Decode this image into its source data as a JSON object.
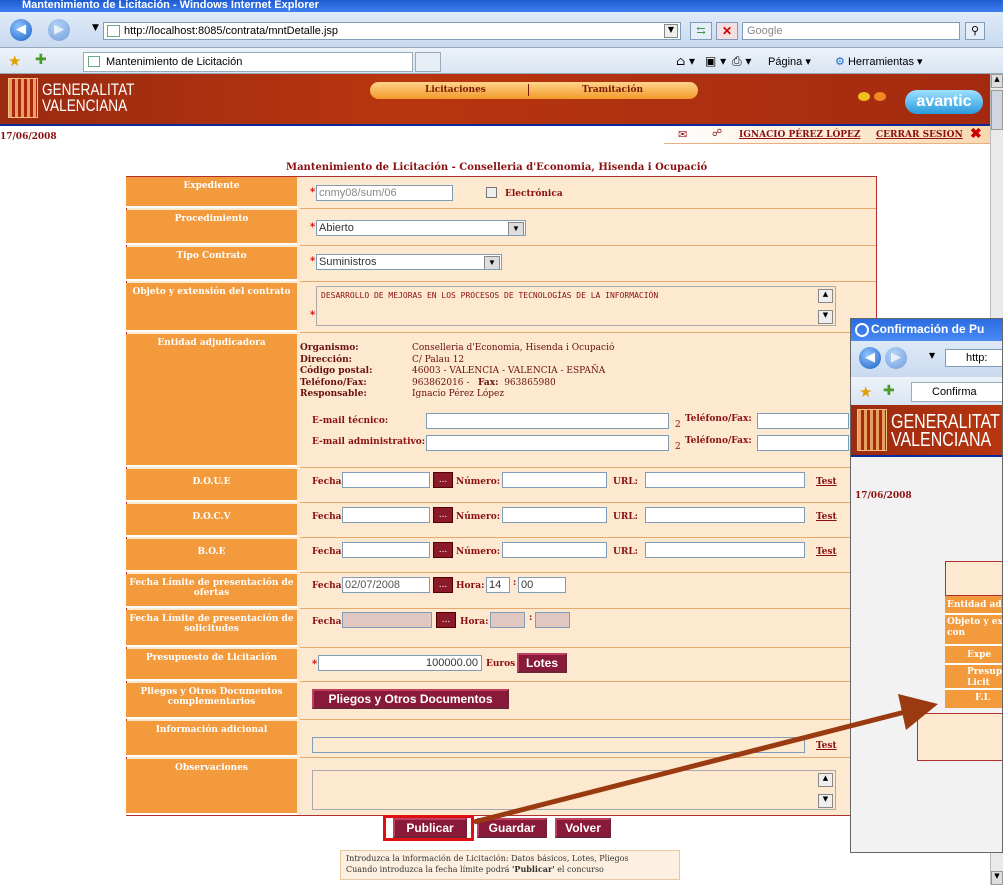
{
  "browser": {
    "window_title": "Mantenimiento de Licitación - Windows Internet Explorer",
    "url": "http://localhost:8085/contrata/mntDetalle.jsp",
    "search_placeholder": "Google",
    "tab_title": "Mantenimiento de Licitación",
    "tools": {
      "page": "Página",
      "tools": "Herramientas"
    }
  },
  "header": {
    "logo_line1": "GENERALITAT",
    "logo_line2": "VALENCIANA",
    "menu": [
      "Licitaciones",
      "Tramitación"
    ],
    "brand": "avantic",
    "date": "17/06/2008",
    "user": "IGNACIO PÉREZ LÓPEZ",
    "logout": "CERRAR SESION"
  },
  "form": {
    "title": "Mantenimiento de Licitación - Conselleria d'Economia, Hisenda i Ocupació",
    "labels": {
      "expediente": "Expediente",
      "procedimiento": "Procedimiento",
      "tipo": "Tipo Contrato",
      "objeto": "Objeto y extensión del contrato",
      "entidad": "Entidad adjudicadora",
      "doue": "D.O.U.E",
      "docv": "D.O.C.V",
      "boe": "B.O.E",
      "limite_ofertas": "Fecha Límite de presentación de ofertas",
      "limite_solicitudes": "Fecha Límite de presentación de solicitudes",
      "presupuesto": "Presupuesto de Licitación",
      "pliegos": "Pliegos y Otros Documentos complementarios",
      "info_adicional": "Información adicional",
      "observaciones": "Observaciones"
    },
    "expediente_value": "cnmy08/sum/06",
    "electronica_label": "Electrónica",
    "procedimiento_value": "Abierto",
    "tipo_value": "Suministros",
    "objeto_value": "DESARROLLO DE MEJORAS EN LOS PROCESOS DE TECNOLOGÍAS DE LA INFORMACIÓN",
    "entidad": {
      "organismo_label": "Organismo:",
      "organismo": "Conselleria d'Economia, Hisenda i Ocupació",
      "direccion_label": "Dirección:",
      "direccion": "C/ Palau 12",
      "cp_label": "Código postal:",
      "cp": "46003 - VALENCIA - VALENCIA - ESPAÑA",
      "tel_label": "Teléfono/Fax:",
      "tel": "963862016 -",
      "fax_label": "Fax:",
      "fax": "963865980",
      "resp_label": "Responsable:",
      "resp": "Ignacio Pérez López",
      "email_tec_label": "E-mail técnico:",
      "email_adm_label": "E-mail administrativo:",
      "telfax_label": "Teléfono/Fax:",
      "sup": "2"
    },
    "fecha_label": "Fecha",
    "numero_label": "Número:",
    "url_label": "URL:",
    "test_label": "Test",
    "dots_label": "...",
    "hora_label": "Hora:",
    "limite_fecha": "02/07/2008",
    "limite_hora": "14",
    "limite_min": "00",
    "presupuesto_value": "100000.00",
    "euros_label": "Euros",
    "lotes_button": "Lotes",
    "pliegos_button": "Pliegos y Otros Documentos",
    "required_mark": "*"
  },
  "actions": {
    "publicar": "Publicar",
    "guardar": "Guardar",
    "volver": "Volver"
  },
  "footer_note": {
    "line1": "Introduzca la información de Licitación: Datos básicos, Lotes, Pliegos",
    "line2_prefix": "Cuando introduzca la fecha límite podrá ",
    "line2_bold": "'Publicar'",
    "line2_suffix": " el concurso"
  },
  "popup": {
    "title": "Confirmación de Pu",
    "url": "http:",
    "tab": "Confirma",
    "logo_line1": "GENERALITAT",
    "logo_line2": "VALENCIANA",
    "date": "17/06/2008",
    "labels": [
      "Entidad ad",
      "Objeto y ex\ncon",
      "Expe",
      "Presup\nLicit",
      "F.L"
    ]
  },
  "annotation": {
    "arrow_color": "#9a3a10",
    "highlight_color": "#e01010"
  }
}
